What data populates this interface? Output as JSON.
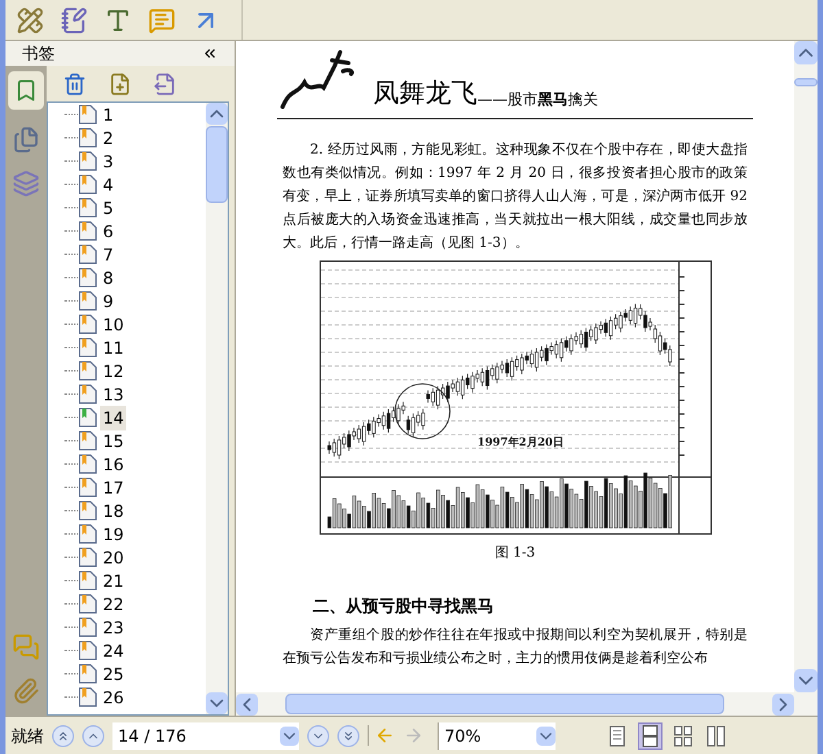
{
  "sidebar": {
    "title": "书签",
    "bookmarks": [
      {
        "label": "1",
        "selected": false
      },
      {
        "label": "2",
        "selected": false
      },
      {
        "label": "3",
        "selected": false
      },
      {
        "label": "4",
        "selected": false
      },
      {
        "label": "5",
        "selected": false
      },
      {
        "label": "6",
        "selected": false
      },
      {
        "label": "7",
        "selected": false
      },
      {
        "label": "8",
        "selected": false
      },
      {
        "label": "9",
        "selected": false
      },
      {
        "label": "10",
        "selected": false
      },
      {
        "label": "11",
        "selected": false
      },
      {
        "label": "12",
        "selected": false
      },
      {
        "label": "13",
        "selected": false
      },
      {
        "label": "14",
        "selected": true
      },
      {
        "label": "15",
        "selected": false
      },
      {
        "label": "16",
        "selected": false
      },
      {
        "label": "17",
        "selected": false
      },
      {
        "label": "18",
        "selected": false
      },
      {
        "label": "19",
        "selected": false
      },
      {
        "label": "20",
        "selected": false
      },
      {
        "label": "21",
        "selected": false
      },
      {
        "label": "22",
        "selected": false
      },
      {
        "label": "23",
        "selected": false
      },
      {
        "label": "24",
        "selected": false
      },
      {
        "label": "25",
        "selected": false
      },
      {
        "label": "26",
        "selected": false
      }
    ]
  },
  "document": {
    "header_title": "凤舞龙飞",
    "header_subtitle": "——股市**黑马**擒关",
    "paragraph_1": "2. 经历过风雨，方能见彩虹。这种现象不仅在个股中存在，即使大盘指数也有类似情况。例如：1997 年 2 月 20 日，很多投资者担心股市的政策有变，早上，证券所填写卖单的窗口挤得人山人海，可是，深沪两市低开 92 点后被庞大的入场资金迅速推高，当天就拉出一根大阳线，成交量也同步放大。此后，行情一路走高（见图 1-3）。",
    "figure_annotation": "1997年2月20日",
    "figure_caption": "图 1-3",
    "heading": "二、从预亏股中寻找黑马",
    "paragraph_2": "资产重组个股的炒作往往在年报或中报期间以利空为契机展开，特别是在预亏公告发布和亏损业绩公布之时，主力的惯用伎俩是趁着利空公布"
  },
  "status_bar": {
    "status": "就绪",
    "page": "14 / 176",
    "zoom": "70%",
    "view_modes": [
      {
        "kind": "single",
        "selected": false
      },
      {
        "kind": "continuous",
        "selected": true
      },
      {
        "kind": "facing",
        "selected": false
      },
      {
        "kind": "continuous-facing",
        "selected": false
      }
    ]
  }
}
